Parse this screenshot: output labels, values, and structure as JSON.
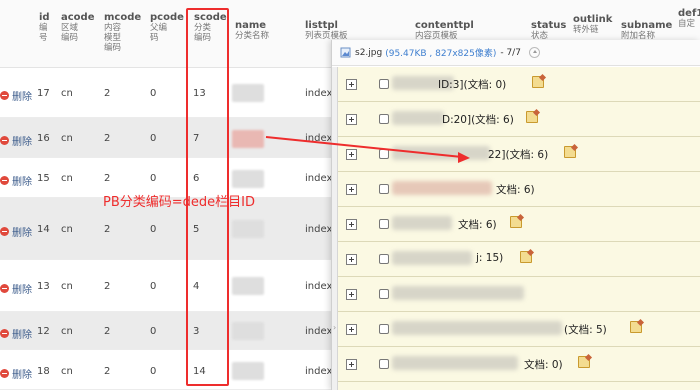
{
  "table": {
    "headers": [
      {
        "en": "id",
        "zh": [
          "编",
          "号"
        ]
      },
      {
        "en": "acode",
        "zh": [
          "区域",
          "编码"
        ]
      },
      {
        "en": "mcode",
        "zh": [
          "内容",
          "模型",
          "编码"
        ]
      },
      {
        "en": "pcode",
        "zh": [
          "父编",
          "码"
        ]
      },
      {
        "en": "scode",
        "zh": [
          "分类",
          "编码"
        ]
      },
      {
        "en": "name",
        "zh": [
          "分类名称"
        ]
      },
      {
        "en": "listtpl",
        "zh": [
          "列表页模板"
        ]
      },
      {
        "en": "contenttpl",
        "zh": [
          "内容页模板"
        ]
      },
      {
        "en": "status",
        "zh": [
          "状态"
        ]
      },
      {
        "en": "outlink",
        "zh": [
          "转外链"
        ]
      },
      {
        "en": "subname",
        "zh": [
          "附加名称"
        ]
      },
      {
        "en": "def1",
        "zh": [
          "自定"
        ]
      }
    ],
    "delete_label": "删除",
    "rows": [
      {
        "id": "17",
        "acode": "cn",
        "mcode": "2",
        "pcode": "0",
        "scode": "13",
        "listtpl": "index"
      },
      {
        "id": "16",
        "acode": "cn",
        "mcode": "2",
        "pcode": "0",
        "scode": "7",
        "listtpl": "index"
      },
      {
        "id": "15",
        "acode": "cn",
        "mcode": "2",
        "pcode": "0",
        "scode": "6",
        "listtpl": "index"
      },
      {
        "id": "14",
        "acode": "cn",
        "mcode": "2",
        "pcode": "0",
        "scode": "5",
        "listtpl": "index"
      },
      {
        "id": "13",
        "acode": "cn",
        "mcode": "2",
        "pcode": "0",
        "scode": "4",
        "listtpl": "index"
      },
      {
        "id": "12",
        "acode": "cn",
        "mcode": "2",
        "pcode": "0",
        "scode": "3",
        "listtpl": "index"
      },
      {
        "id": "18",
        "acode": "cn",
        "mcode": "2",
        "pcode": "0",
        "scode": "14",
        "listtpl": "index"
      }
    ]
  },
  "annotation": {
    "text": "PB分类编码=dede栏目ID",
    "color": "#ee2d2d"
  },
  "viewer": {
    "file_name": "s2.jpg",
    "file_info": "(95.47KB , 827x825像素)",
    "pager": "- 7/7",
    "items": [
      {
        "text": "ID:3](文档: 0)"
      },
      {
        "text": "D:20](文档: 6)"
      },
      {
        "text": "22](文档: 6)"
      },
      {
        "text": "文档: 6)"
      },
      {
        "text": "文档: 6)"
      },
      {
        "text": "j: 15)"
      },
      {
        "text": ""
      },
      {
        "text": "(文档: 5)"
      },
      {
        "text": "文档: 0)"
      }
    ]
  }
}
